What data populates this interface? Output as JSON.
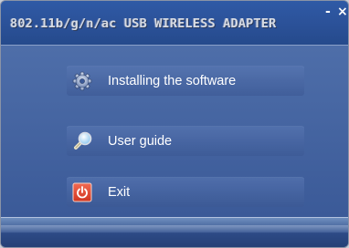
{
  "window": {
    "title": "802.11b/g/n/ac USB WIRELESS ADAPTER",
    "minimize_glyph": "-",
    "close_glyph": "×"
  },
  "menu": [
    {
      "label": "Installing the software",
      "icon": "gear-icon"
    },
    {
      "label": "User guide",
      "icon": "magnifier-icon"
    },
    {
      "label": "Exit",
      "icon": "power-icon"
    }
  ],
  "colors": {
    "title_bar": "#2b5198",
    "body": "#3b5a98",
    "exit_icon": "#e0432f"
  }
}
